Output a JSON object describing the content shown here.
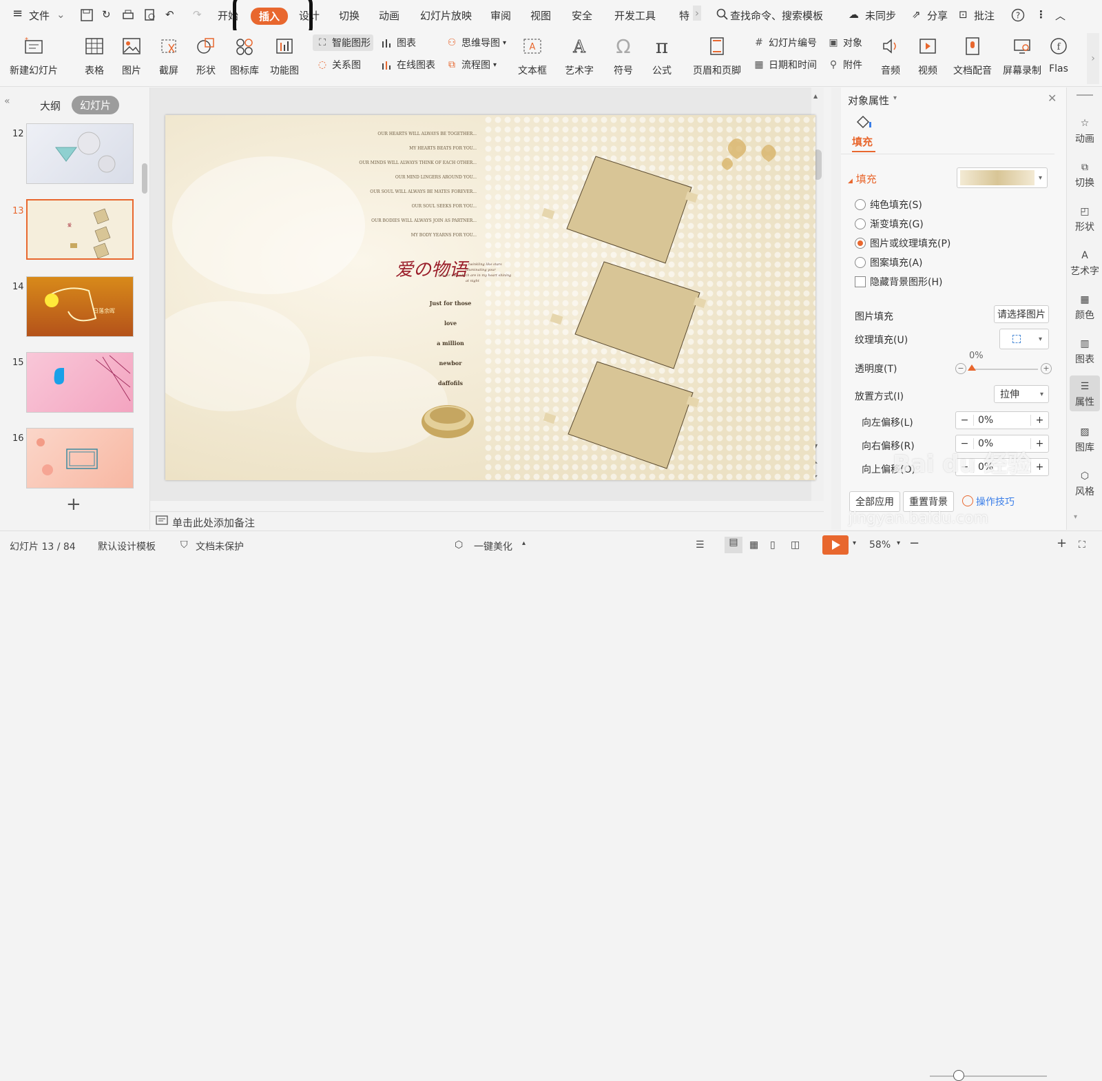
{
  "menubar": {
    "file_label": "文件",
    "tabs": [
      "开始",
      "插入",
      "设计",
      "切换",
      "动画",
      "幻灯片放映",
      "审阅",
      "视图",
      "安全",
      "开发工具",
      "特"
    ],
    "search_placeholder": "查找命令、搜索模板",
    "sync_label": "未同步",
    "share_label": "分享",
    "comment_label": "批注"
  },
  "ribbon": {
    "new_slide": "新建幻灯片",
    "table": "表格",
    "picture": "图片",
    "screenshot": "截屏",
    "shape": "形状",
    "icon_lib": "图标库",
    "function_chart": "功能图",
    "smart_art": "智能图形",
    "chart": "图表",
    "mind_map": "思维导图",
    "relation": "关系图",
    "online_chart": "在线图表",
    "flowchart": "流程图",
    "textbox": "文本框",
    "wordart": "艺术字",
    "symbol": "符号",
    "formula": "公式",
    "header_footer": "页眉和页脚",
    "slide_number": "幻灯片编号",
    "object": "对象",
    "date_time": "日期和时间",
    "attachment": "附件",
    "audio": "音频",
    "video": "视频",
    "doc_voice": "文档配音",
    "screen_record": "屏幕录制",
    "flash": "Flas"
  },
  "leftpanel": {
    "tab_outline": "大纲",
    "tab_slides": "幻灯片",
    "slides": [
      {
        "num": "12"
      },
      {
        "num": "13"
      },
      {
        "num": "14"
      },
      {
        "num": "15"
      },
      {
        "num": "16"
      }
    ],
    "add_label": "+"
  },
  "slide": {
    "quotes": [
      "OUR HEARTS WILL ALWAYS BE TOGETHER...",
      "MY HEARTS BEATS FOR YOU...",
      "OUR MINDS WILL ALWAYS THINK OF EACH OTHER...",
      "OUR MIND LINGERS AROUND YOU...",
      "OUR SOUL WILL ALWAYS BE MATES FOREVER...",
      "OUR SOUL SEEKS FOR YOU...",
      "OUR BODIES WILL ALWAYS JOIN AS PARTNER...",
      "MY BODY YEARNS FOR YOU..."
    ],
    "logo_text": "爱の物语",
    "logo_sub1": "twinkling like stars",
    "logo_sub2": "illuminating your",
    "logo_sub3": "live for me, which are in my heart shining",
    "logo_sub4": "at night",
    "words": [
      "Just for those",
      "love",
      "a million",
      "newbor",
      "daffofils"
    ]
  },
  "notes_placeholder": "单击此处添加备注",
  "rightpanel": {
    "title": "对象属性",
    "tab_fill": "填充",
    "section_fill": "填充",
    "options": [
      "纯色填充(S)",
      "渐变填充(G)",
      "图片或纹理填充(P)",
      "图案填充(A)"
    ],
    "hide_bg": "隐藏背景图形(H)",
    "picture_fill": "图片填充",
    "choose_picture": "请选择图片",
    "texture_fill": "纹理填充(U)",
    "transparency": "透明度(T)",
    "transparency_value": "0%",
    "placement": "放置方式(I)",
    "placement_value": "拉伸",
    "offset_left": "向左偏移(L)",
    "offset_left_value": "0%",
    "offset_right": "向右偏移(R)",
    "offset_right_value": "0%",
    "offset_up": "向上偏移(O)",
    "offset_up_value": "0%",
    "apply_all": "全部应用",
    "reset_bg": "重置背景",
    "tips": "操作技巧"
  },
  "rightbar": [
    "动画",
    "切换",
    "形状",
    "艺术字",
    "颜色",
    "图表",
    "属性",
    "图库",
    "风格"
  ],
  "statusbar": {
    "slide_pos": "幻灯片 13 / 84",
    "template": "默认设计模板",
    "protect": "文档未保护",
    "beautify": "一键美化",
    "zoom": "58%"
  },
  "watermark": {
    "brand": "Bai du 经验",
    "url": "jingyan.baidu.com"
  },
  "colors": {
    "accent": "#e8672e",
    "slide_bg": "#f8f2e2",
    "frame_fill": "#d8c596"
  }
}
